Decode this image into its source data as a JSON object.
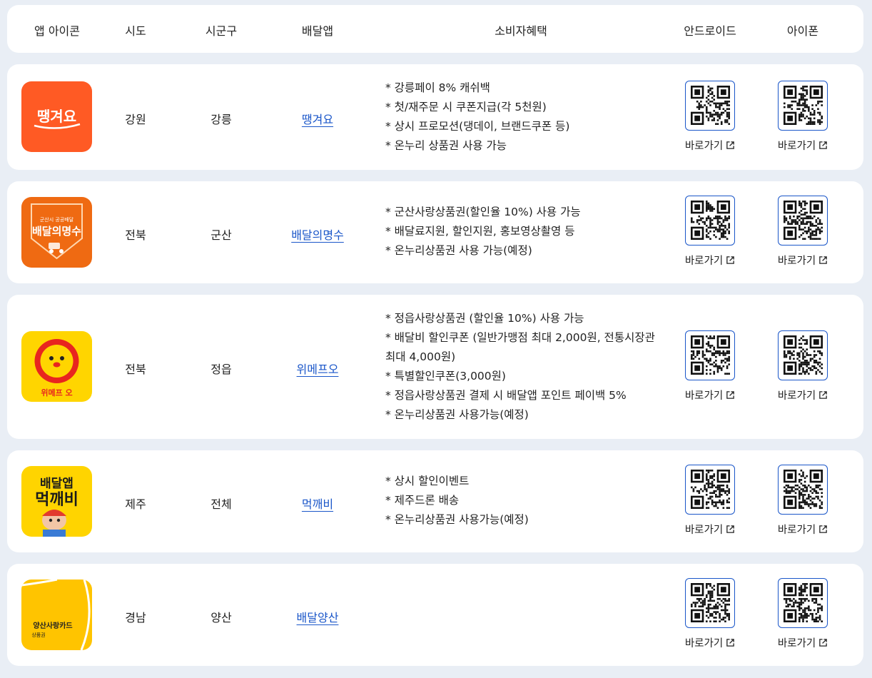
{
  "header": {
    "icon": "앱 아이콘",
    "sido": "시도",
    "sigungu": "시군구",
    "app": "배달앱",
    "benefit": "소비자혜택",
    "android": "안드로이드",
    "ios": "아이폰"
  },
  "go_label": "바로가기",
  "link_color": "#1a56c9",
  "rows": [
    {
      "sido": "강원",
      "sigungu": "강릉",
      "app": "땡겨요",
      "logo_text": "땡겨요",
      "logo_color": "#ff5a24",
      "benefits": [
        "* 강릉페이 8% 캐쉬백",
        "* 첫/재주문 시 쿠폰지급(각 5천원)",
        "* 상시 프로모션(댕데이, 브랜드쿠폰 등)",
        "* 온누리 상품권 사용 가능"
      ]
    },
    {
      "sido": "전북",
      "sigungu": "군산",
      "app": "배달의명수",
      "logo_text": "배달의명수",
      "logo_sub": "군산시 공공배달",
      "logo_color": "#ef6a12",
      "benefits": [
        "* 군산사랑상품권(할인율 10%) 사용 가능",
        "* 배달료지원, 할인지원, 홍보영상촬영 등",
        "* 온누리상품권 사용 가능(예정)"
      ]
    },
    {
      "sido": "전북",
      "sigungu": "정읍",
      "app": "위메프오",
      "logo_text": "위메프 오",
      "logo_color": "#ffd500",
      "benefits": [
        "* 정읍사랑상품권 (할인율 10%) 사용 가능",
        "* 배달비 할인쿠폰 (일반가맹점 최대 2,000원, 전통시장관 최대 4,000원)",
        "* 특별할인쿠폰(3,000원)",
        "* 정읍사랑상품권 결제 시 배달앱 포인트 페이백 5%",
        "* 온누리상품권 사용가능(예정)"
      ]
    },
    {
      "sido": "제주",
      "sigungu": "전체",
      "app": "먹깨비",
      "logo_text": "배달앱",
      "logo_text2": "먹깨비",
      "logo_color": "#ffd400",
      "benefits": [
        "* 상시 할인이벤트",
        "* 제주드론 배송",
        "* 온누리상품권 사용가능(예정)"
      ]
    },
    {
      "sido": "경남",
      "sigungu": "양산",
      "app": "배달양산",
      "logo_text": "양산사랑카드",
      "logo_sub": "상품권",
      "logo_color": "#ffc400",
      "benefits": []
    }
  ]
}
